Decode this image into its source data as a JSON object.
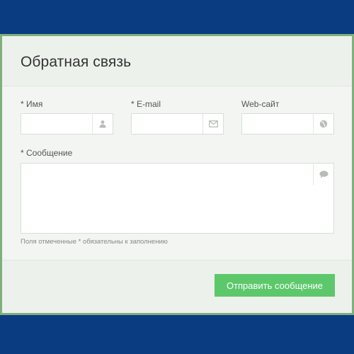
{
  "form": {
    "title": "Обратная связь",
    "fields": {
      "name": {
        "label": "* Имя",
        "value": "",
        "icon": "user-icon"
      },
      "email": {
        "label": "* E-mail",
        "value": "",
        "icon": "envelope-icon"
      },
      "website": {
        "label": "Web-сайт",
        "value": "",
        "icon": "globe-icon"
      },
      "message": {
        "label": "* Сообщение",
        "value": "",
        "icon": "speech-bubble-icon"
      }
    },
    "note": "Поля отмеченные * обязательны к заполнению",
    "submit_label": "Отправить сообщение"
  },
  "colors": {
    "background": "#0a3c82",
    "card_border": "#7fb07a",
    "submit": "#5cc86b"
  }
}
